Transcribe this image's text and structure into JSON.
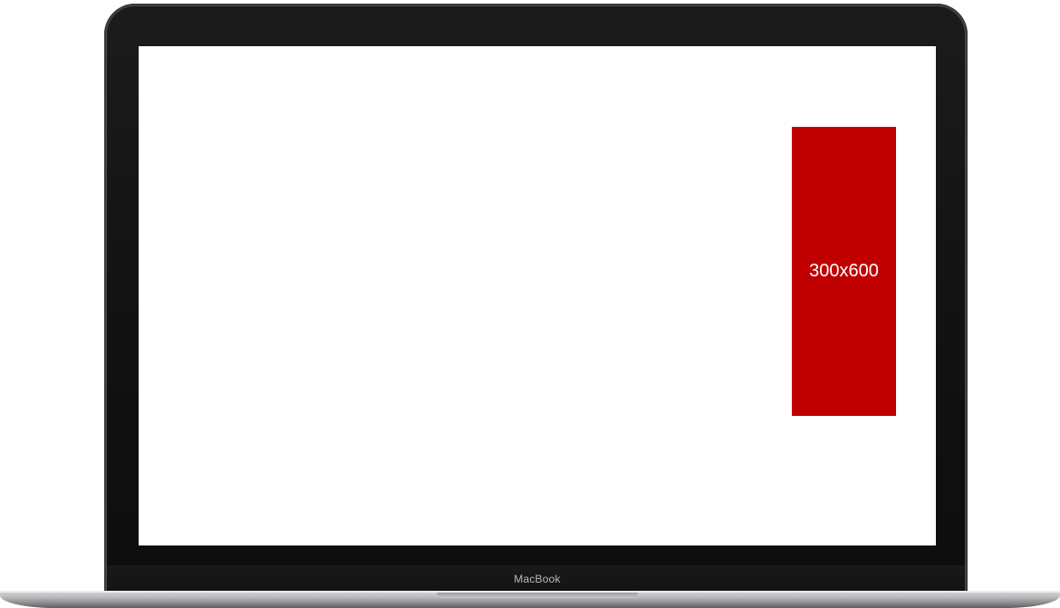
{
  "device": {
    "brand_label": "MacBook"
  },
  "ad_slot": {
    "size_label": "300x600",
    "color": "#c00000"
  }
}
